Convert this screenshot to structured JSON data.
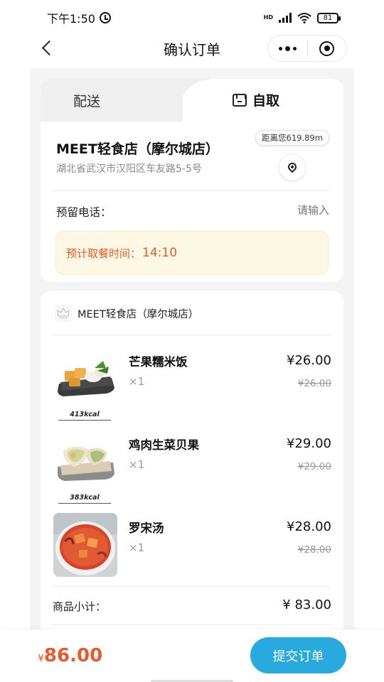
{
  "status_bar": {
    "time": "下午1:50",
    "battery": "81",
    "network": "HD"
  },
  "nav": {
    "title": "确认订单"
  },
  "tabs": {
    "delivery": "配送",
    "pickup": "自取",
    "active": "pickup"
  },
  "store": {
    "name": "MEET轻食店（摩尔城店）",
    "address": "湖北省武汉市汉阳区车友路5-5号",
    "distance": "距离您619.89m"
  },
  "phone": {
    "label": "预留电话：",
    "placeholder": "请输入"
  },
  "pickup_time": {
    "label": "预计取餐时间：",
    "value": "14:10"
  },
  "shop_header": {
    "name": "MEET轻食店（摩尔城店）"
  },
  "items": [
    {
      "name": "芒果糯米饭",
      "qty": "×1",
      "price": "¥26.00",
      "original_price": "¥26.00",
      "kcal": "413kcal"
    },
    {
      "name": "鸡肉生菜贝果",
      "qty": "×1",
      "price": "¥29.00",
      "original_price": "¥29.00",
      "kcal": "383kcal"
    },
    {
      "name": "罗宋汤",
      "qty": "×1",
      "price": "¥28.00",
      "original_price": "¥28.00",
      "kcal": ""
    }
  ],
  "subtotal": {
    "label": "商品小计：",
    "value": "¥ 83.00"
  },
  "footer": {
    "currency": "¥",
    "total": "86.00",
    "submit_label": "提交订单"
  },
  "colors": {
    "accent": "#29aadf",
    "price_red": "#e85a2e",
    "notice_bg": "#fdf8e4"
  }
}
